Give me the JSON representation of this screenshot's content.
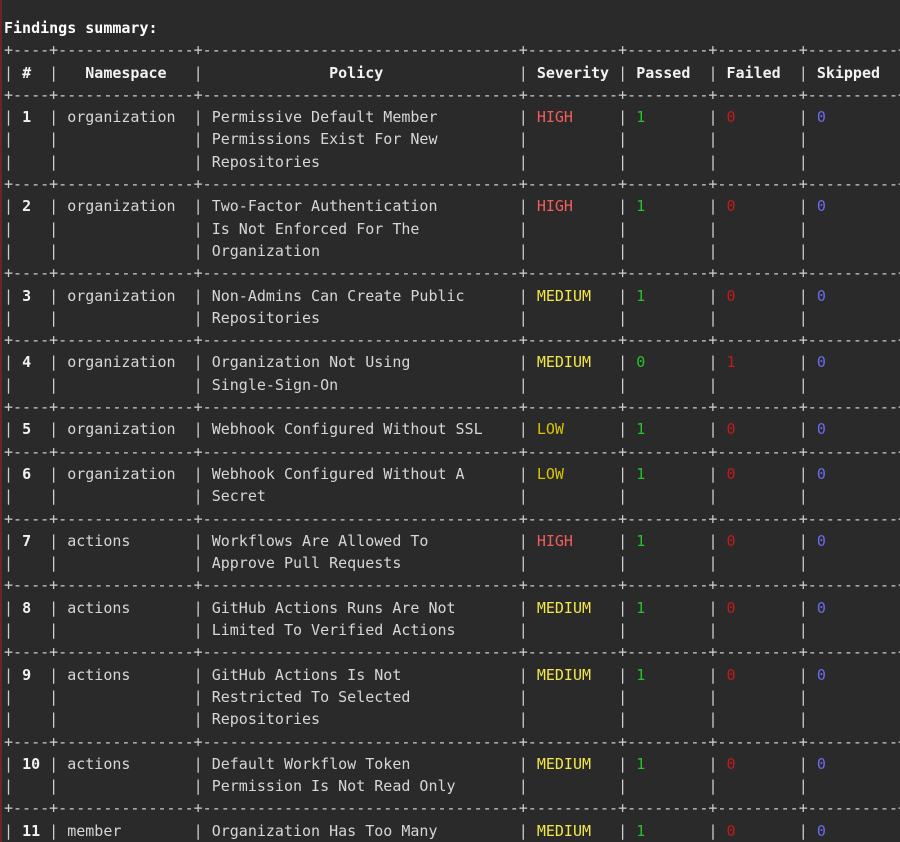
{
  "title": "Findings summary:",
  "colors": {
    "background": "#2a2a2a",
    "text": "#d6d6d6",
    "HIGH": "#f25c5c",
    "MEDIUM": "#f2e84a",
    "LOW": "#d9c400",
    "passed": "#27c22a",
    "failed": "#c41a1a",
    "skipped": "#6b6bf0"
  },
  "columns": [
    "#",
    "Namespace",
    "Policy",
    "Severity",
    "Passed",
    "Failed",
    "Skipped"
  ],
  "rows": [
    {
      "num": "1",
      "namespace": "organization",
      "policy": [
        "Permissive Default Member",
        "Permissions Exist For New",
        "Repositories"
      ],
      "severity": "HIGH",
      "passed": "1",
      "failed": "0",
      "skipped": "0"
    },
    {
      "num": "2",
      "namespace": "organization",
      "policy": [
        "Two-Factor Authentication",
        "Is Not Enforced For The",
        "Organization"
      ],
      "severity": "HIGH",
      "passed": "1",
      "failed": "0",
      "skipped": "0"
    },
    {
      "num": "3",
      "namespace": "organization",
      "policy": [
        "Non-Admins Can Create Public",
        "Repositories"
      ],
      "severity": "MEDIUM",
      "passed": "1",
      "failed": "0",
      "skipped": "0"
    },
    {
      "num": "4",
      "namespace": "organization",
      "policy": [
        "Organization Not Using",
        "Single-Sign-On"
      ],
      "severity": "MEDIUM",
      "passed": "0",
      "failed": "1",
      "skipped": "0"
    },
    {
      "num": "5",
      "namespace": "organization",
      "policy": [
        "Webhook Configured Without SSL"
      ],
      "severity": "LOW",
      "passed": "1",
      "failed": "0",
      "skipped": "0"
    },
    {
      "num": "6",
      "namespace": "organization",
      "policy": [
        "Webhook Configured Without A",
        "Secret"
      ],
      "severity": "LOW",
      "passed": "1",
      "failed": "0",
      "skipped": "0"
    },
    {
      "num": "7",
      "namespace": "actions",
      "policy": [
        "Workflows Are Allowed To",
        "Approve Pull Requests"
      ],
      "severity": "HIGH",
      "passed": "1",
      "failed": "0",
      "skipped": "0"
    },
    {
      "num": "8",
      "namespace": "actions",
      "policy": [
        "GitHub Actions Runs Are Not",
        "Limited To Verified Actions"
      ],
      "severity": "MEDIUM",
      "passed": "1",
      "failed": "0",
      "skipped": "0"
    },
    {
      "num": "9",
      "namespace": "actions",
      "policy": [
        "GitHub Actions Is Not",
        "Restricted To Selected",
        "Repositories"
      ],
      "severity": "MEDIUM",
      "passed": "1",
      "failed": "0",
      "skipped": "0"
    },
    {
      "num": "10",
      "namespace": "actions",
      "policy": [
        "Default Workflow Token",
        "Permission Is Not Read Only"
      ],
      "severity": "MEDIUM",
      "passed": "1",
      "failed": "0",
      "skipped": "0"
    },
    {
      "num": "11",
      "namespace": "member",
      "policy": [
        "Organization Has Too Many"
      ],
      "severity": "MEDIUM",
      "passed": "1",
      "failed": "0",
      "skipped": "0"
    }
  ]
}
